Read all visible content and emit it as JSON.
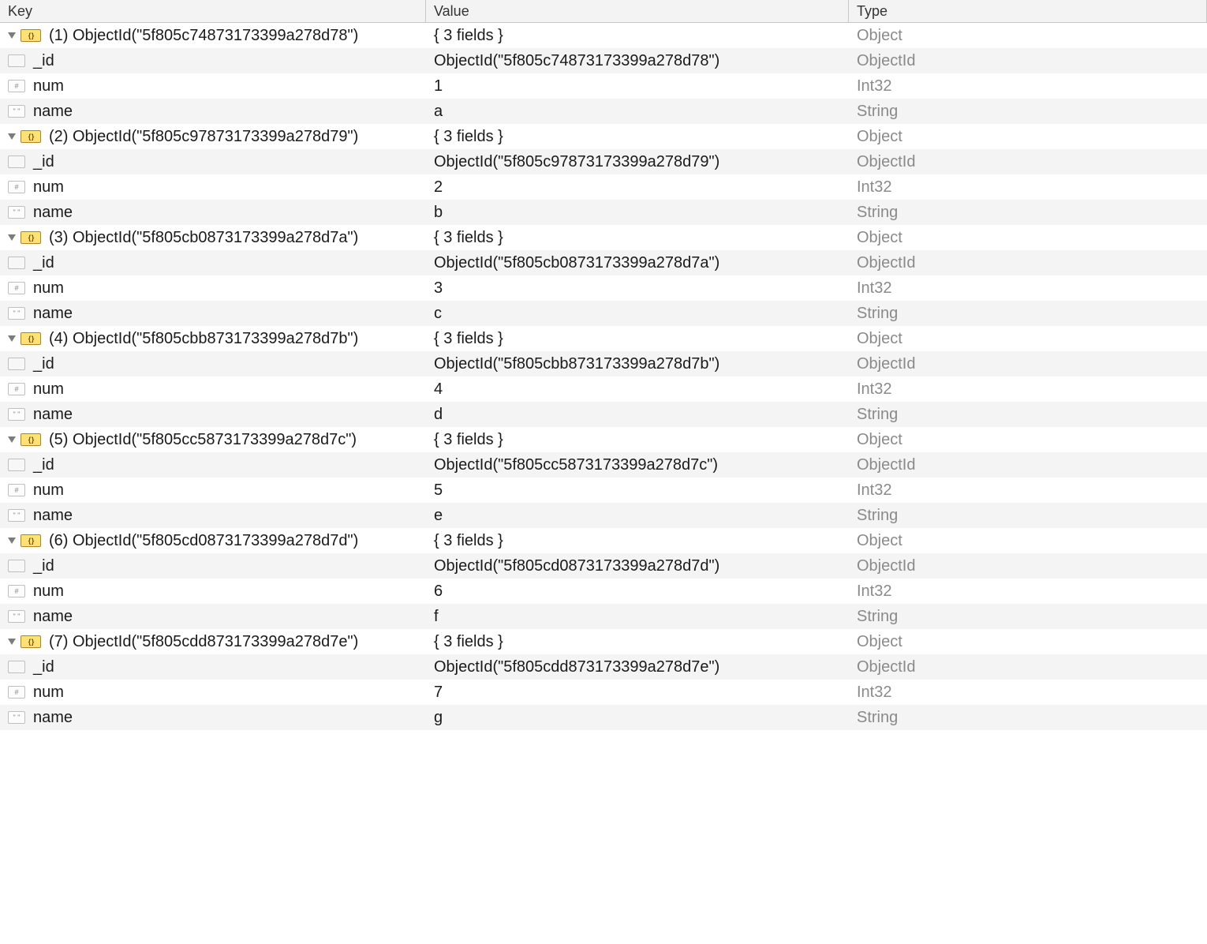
{
  "columns": {
    "key": "Key",
    "value": "Value",
    "type": "Type"
  },
  "docs": [
    {
      "index": "(1)",
      "key": "ObjectId(\"5f805c74873173399a278d78\")",
      "value": "{ 3 fields }",
      "type": "Object",
      "fields": [
        {
          "name": "_id",
          "value": "ObjectId(\"5f805c74873173399a278d78\")",
          "type": "ObjectId",
          "icon": "id"
        },
        {
          "name": "num",
          "value": "1",
          "type": "Int32",
          "icon": "num"
        },
        {
          "name": "name",
          "value": "a",
          "type": "String",
          "icon": "str"
        }
      ]
    },
    {
      "index": "(2)",
      "key": "ObjectId(\"5f805c97873173399a278d79\")",
      "value": "{ 3 fields }",
      "type": "Object",
      "fields": [
        {
          "name": "_id",
          "value": "ObjectId(\"5f805c97873173399a278d79\")",
          "type": "ObjectId",
          "icon": "id"
        },
        {
          "name": "num",
          "value": "2",
          "type": "Int32",
          "icon": "num"
        },
        {
          "name": "name",
          "value": "b",
          "type": "String",
          "icon": "str"
        }
      ]
    },
    {
      "index": "(3)",
      "key": "ObjectId(\"5f805cb0873173399a278d7a\")",
      "value": "{ 3 fields }",
      "type": "Object",
      "fields": [
        {
          "name": "_id",
          "value": "ObjectId(\"5f805cb0873173399a278d7a\")",
          "type": "ObjectId",
          "icon": "id"
        },
        {
          "name": "num",
          "value": "3",
          "type": "Int32",
          "icon": "num"
        },
        {
          "name": "name",
          "value": "c",
          "type": "String",
          "icon": "str"
        }
      ]
    },
    {
      "index": "(4)",
      "key": "ObjectId(\"5f805cbb873173399a278d7b\")",
      "value": "{ 3 fields }",
      "type": "Object",
      "fields": [
        {
          "name": "_id",
          "value": "ObjectId(\"5f805cbb873173399a278d7b\")",
          "type": "ObjectId",
          "icon": "id"
        },
        {
          "name": "num",
          "value": "4",
          "type": "Int32",
          "icon": "num"
        },
        {
          "name": "name",
          "value": "d",
          "type": "String",
          "icon": "str"
        }
      ]
    },
    {
      "index": "(5)",
      "key": "ObjectId(\"5f805cc5873173399a278d7c\")",
      "value": "{ 3 fields }",
      "type": "Object",
      "fields": [
        {
          "name": "_id",
          "value": "ObjectId(\"5f805cc5873173399a278d7c\")",
          "type": "ObjectId",
          "icon": "id"
        },
        {
          "name": "num",
          "value": "5",
          "type": "Int32",
          "icon": "num"
        },
        {
          "name": "name",
          "value": "e",
          "type": "String",
          "icon": "str"
        }
      ]
    },
    {
      "index": "(6)",
      "key": "ObjectId(\"5f805cd0873173399a278d7d\")",
      "value": "{ 3 fields }",
      "type": "Object",
      "fields": [
        {
          "name": "_id",
          "value": "ObjectId(\"5f805cd0873173399a278d7d\")",
          "type": "ObjectId",
          "icon": "id"
        },
        {
          "name": "num",
          "value": "6",
          "type": "Int32",
          "icon": "num"
        },
        {
          "name": "name",
          "value": "f",
          "type": "String",
          "icon": "str"
        }
      ]
    },
    {
      "index": "(7)",
      "key": "ObjectId(\"5f805cdd873173399a278d7e\")",
      "value": "{ 3 fields }",
      "type": "Object",
      "fields": [
        {
          "name": "_id",
          "value": "ObjectId(\"5f805cdd873173399a278d7e\")",
          "type": "ObjectId",
          "icon": "id"
        },
        {
          "name": "num",
          "value": "7",
          "type": "Int32",
          "icon": "num"
        },
        {
          "name": "name",
          "value": "g",
          "type": "String",
          "icon": "str"
        }
      ]
    }
  ],
  "iconGlyphs": {
    "doc": "{ }",
    "id": "",
    "num": "#",
    "str": "\" \""
  }
}
